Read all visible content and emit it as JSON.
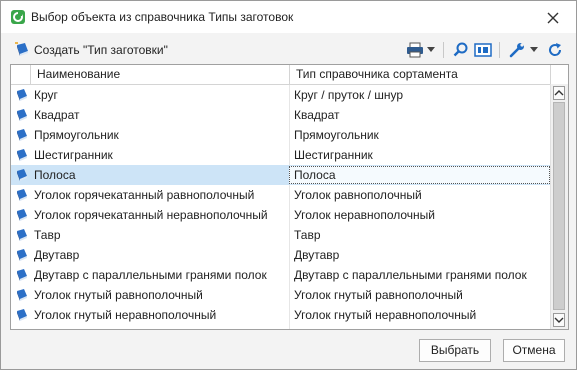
{
  "window": {
    "title": "Выбор объекта из справочника Типы заготовок",
    "close_glyph": "✕"
  },
  "toolbar": {
    "create_label": "Создать \"Тип заготовки\"",
    "icons": [
      "print-icon",
      "dropdown-arrow-icon",
      "search-icon",
      "view-toggle-icon",
      "settings-wrench-icon",
      "refresh-icon"
    ]
  },
  "grid": {
    "columns": [
      "Наименование",
      "Тип справочника сортамента"
    ],
    "rows": [
      {
        "name": "Круг",
        "type": "Круг / пруток / шнур"
      },
      {
        "name": "Квадрат",
        "type": "Квадрат"
      },
      {
        "name": "Прямоугольник",
        "type": "Прямоугольник"
      },
      {
        "name": "Шестигранник",
        "type": "Шестигранник"
      },
      {
        "name": "Полоса",
        "type": "Полоса"
      },
      {
        "name": "Уголок горячекатанный равнополочный",
        "type": "Уголок равнополочный"
      },
      {
        "name": "Уголок горячекатанный неравнополочный",
        "type": "Уголок неравнополочный"
      },
      {
        "name": "Тавр",
        "type": "Тавр"
      },
      {
        "name": "Двутавр",
        "type": "Двутавр"
      },
      {
        "name": "Двутавр с параллельными гранями полок",
        "type": "Двутавр с параллельными гранями полок"
      },
      {
        "name": "Уголок гнутый равнополочный",
        "type": "Уголок гнутый равнополочный"
      },
      {
        "name": "Уголок гнутый неравнополочный",
        "type": "Уголок гнутый неравнополочный"
      }
    ],
    "selected_row": 4
  },
  "buttons": {
    "select_label": "Выбрать",
    "cancel_label": "Отмена"
  },
  "colors": {
    "selection": "#cde4f7",
    "app_icon_green": "#3aa64a",
    "book_icon_blue": "#2b6fc7",
    "accent_blue": "#1e6bc4"
  }
}
